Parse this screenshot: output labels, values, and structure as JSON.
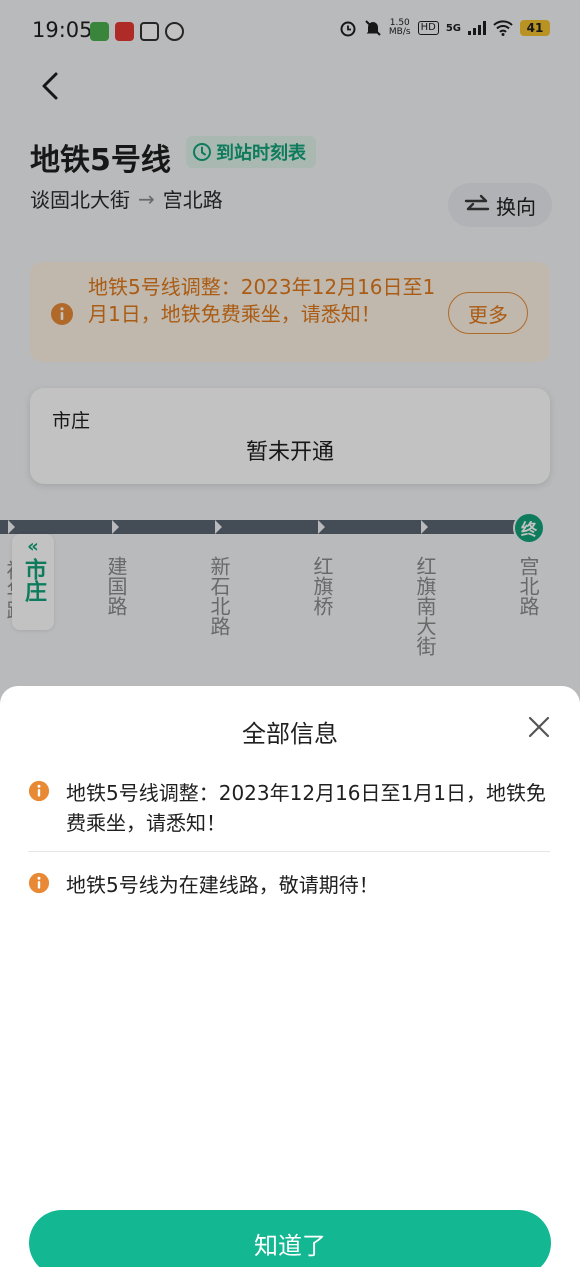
{
  "status_bar": {
    "time": "19:05",
    "speed_value": "1.50",
    "speed_unit": "MB/s",
    "hd": "HD",
    "network": "5G",
    "battery": "41"
  },
  "header": {
    "title": "地铁5号线",
    "timetable_label": "到站时刻表",
    "from_station": "谈固北大街",
    "arrow": "→",
    "to_station": "宫北路",
    "switch_label": "换向"
  },
  "notice": {
    "text": "地铁5号线调整：2023年12月16日至1月1日，地铁免费乘坐，请悉知！",
    "more_label": "更多"
  },
  "station_card": {
    "name": "市庄",
    "status": "暂未开通"
  },
  "route": {
    "current": {
      "marker": "«",
      "name": "市庄"
    },
    "partial_previous": "裕华路",
    "stations": [
      "建国路",
      "新石北路",
      "红旗桥",
      "红旗南大街",
      "宫北路"
    ],
    "end_badge": "终"
  },
  "sheet": {
    "title": "全部信息",
    "messages": [
      "地铁5号线调整：2023年12月16日至1月1日，地铁免费乘坐，请悉知！",
      "地铁5号线为在建线路，敬请期待！"
    ],
    "confirm_label": "知道了"
  },
  "colors": {
    "accent_green": "#13a37a",
    "button_green": "#13b893",
    "warning_orange": "#e07a1b",
    "notice_bg": "#fdf2e4",
    "route_line": "#5a6472"
  }
}
